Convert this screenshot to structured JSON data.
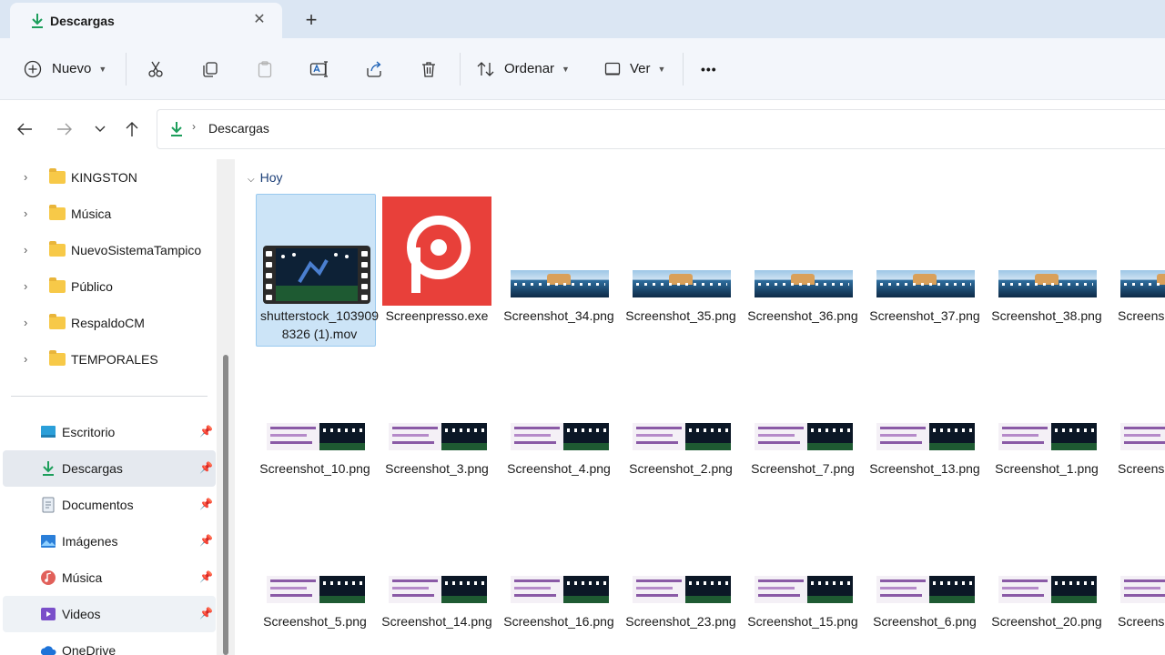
{
  "tab": {
    "title": "Descargas",
    "close_glyph": "✕",
    "new_glyph": "+"
  },
  "toolbar": {
    "new_label": "Nuevo",
    "sort_label": "Ordenar",
    "view_label": "Ver",
    "more_glyph": "•••"
  },
  "address": {
    "crumb": "Descargas",
    "separator": "›"
  },
  "sidebar": {
    "folders": [
      {
        "label": "KINGSTON"
      },
      {
        "label": "Música"
      },
      {
        "label": "NuevoSistemaTampico"
      },
      {
        "label": "Público"
      },
      {
        "label": "RespaldoCM"
      },
      {
        "label": "TEMPORALES"
      }
    ],
    "quick_access": [
      {
        "label": "Escritorio",
        "icon": "desktop-icon"
      },
      {
        "label": "Descargas",
        "icon": "download-icon"
      },
      {
        "label": "Documentos",
        "icon": "documents-icon"
      },
      {
        "label": "Imágenes",
        "icon": "pictures-icon"
      },
      {
        "label": "Música",
        "icon": "music-icon"
      },
      {
        "label": "Videos",
        "icon": "videos-icon"
      },
      {
        "label": "OneDrive",
        "icon": "onedrive-icon"
      }
    ],
    "pin_glyph": "📌"
  },
  "content": {
    "group_label": "Hoy",
    "files_row1": [
      {
        "name": "shutterstock_1039098326 (1).mov"
      },
      {
        "name": "Screenpresso.exe"
      },
      {
        "name": "Screenshot_34.png"
      },
      {
        "name": "Screenshot_35.png"
      },
      {
        "name": "Screenshot_36.png"
      },
      {
        "name": "Screenshot_37.png"
      },
      {
        "name": "Screenshot_38.png"
      },
      {
        "name": "Screensh"
      }
    ],
    "files_row2": [
      {
        "name": "Screenshot_10.png"
      },
      {
        "name": "Screenshot_3.png"
      },
      {
        "name": "Screenshot_4.png"
      },
      {
        "name": "Screenshot_2.png"
      },
      {
        "name": "Screenshot_7.png"
      },
      {
        "name": "Screenshot_13.png"
      },
      {
        "name": "Screenshot_1.png"
      },
      {
        "name": "Screensh"
      }
    ],
    "files_row3": [
      {
        "name": "Screenshot_5.png"
      },
      {
        "name": "Screenshot_14.png"
      },
      {
        "name": "Screenshot_16.png"
      },
      {
        "name": "Screenshot_23.png"
      },
      {
        "name": "Screenshot_15.png"
      },
      {
        "name": "Screenshot_6.png"
      },
      {
        "name": "Screenshot_20.png"
      },
      {
        "name": "Screensh"
      }
    ]
  },
  "colors": {
    "accent": "#1c9e5b",
    "selection": "#cce4f7",
    "screenpresso_red": "#e8403a"
  }
}
